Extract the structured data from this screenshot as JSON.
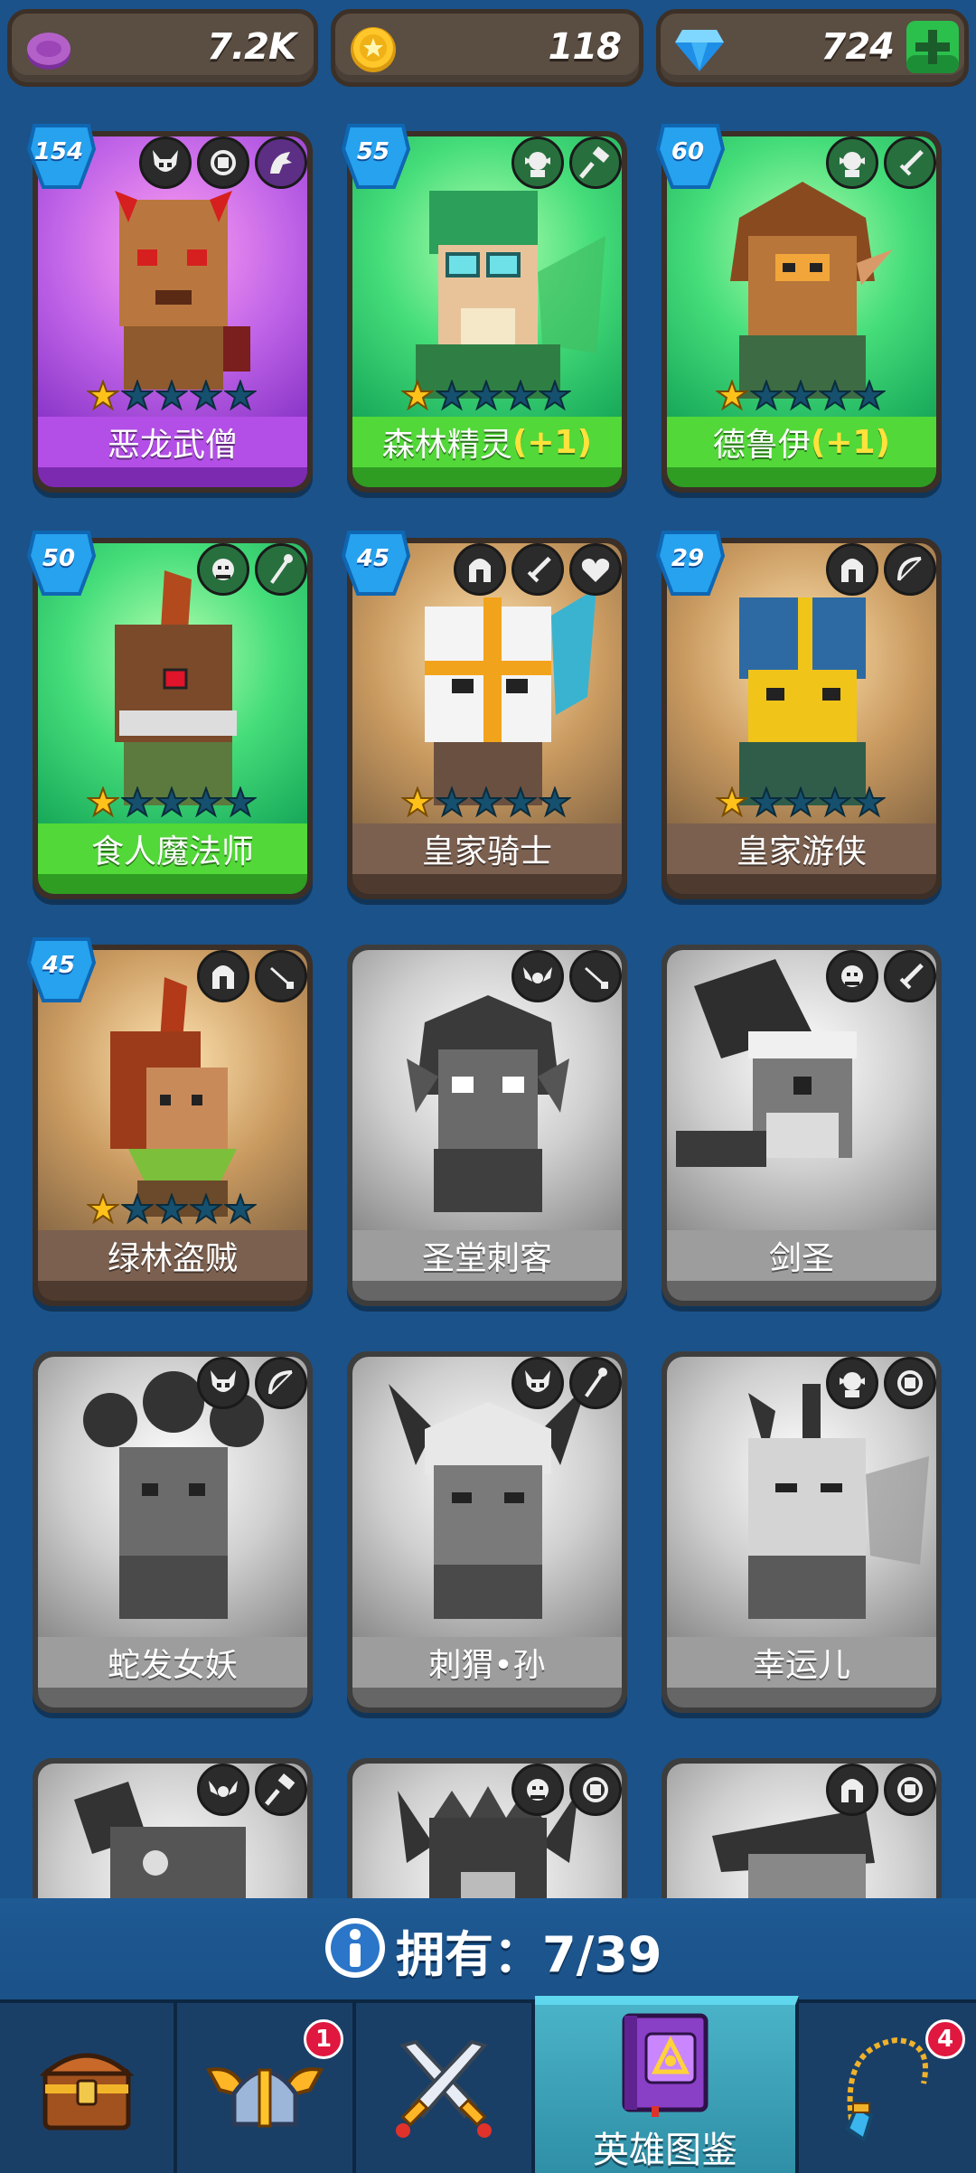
{
  "currencies": {
    "gems_purple": "7.2K",
    "coins": "118",
    "diamonds": "724"
  },
  "heroes": [
    {
      "name": "恶龙武僧",
      "level": "154",
      "plus": ""
    },
    {
      "name": "森林精灵",
      "level": "55",
      "plus": "(+1)"
    },
    {
      "name": "德鲁伊",
      "level": "60",
      "plus": "(+1)"
    },
    {
      "name": "食人魔法师",
      "level": "50",
      "plus": ""
    },
    {
      "name": "皇家骑士",
      "level": "45",
      "plus": ""
    },
    {
      "name": "皇家游侠",
      "level": "29",
      "plus": ""
    },
    {
      "name": "绿林盗贼",
      "level": "45",
      "plus": ""
    },
    {
      "name": "圣堂刺客",
      "level": "",
      "plus": ""
    },
    {
      "name": "剑圣",
      "level": "",
      "plus": ""
    },
    {
      "name": "蛇发女妖",
      "level": "",
      "plus": ""
    },
    {
      "name": "刺猬•孙",
      "level": "",
      "plus": ""
    },
    {
      "name": "幸运儿",
      "level": "",
      "plus": ""
    }
  ],
  "owned": {
    "label": "拥有：",
    "count": "7/39"
  },
  "nav": {
    "tabs": [
      {
        "label": "",
        "icon": "treasure-chest-icon"
      },
      {
        "label": "",
        "icon": "winged-helmet-icon",
        "badge": "1"
      },
      {
        "label": "",
        "icon": "crossed-swords-icon"
      },
      {
        "label": "英雄图鉴",
        "icon": "hero-book-icon"
      },
      {
        "label": "",
        "icon": "amulet-icon",
        "badge": "4"
      }
    ]
  },
  "colors": {
    "background": "#1b5289",
    "rarity_purple": "#b34fe6",
    "rarity_green": "#52d838",
    "rarity_brown": "#7b6050",
    "locked_gray": "#9d9d9d"
  }
}
